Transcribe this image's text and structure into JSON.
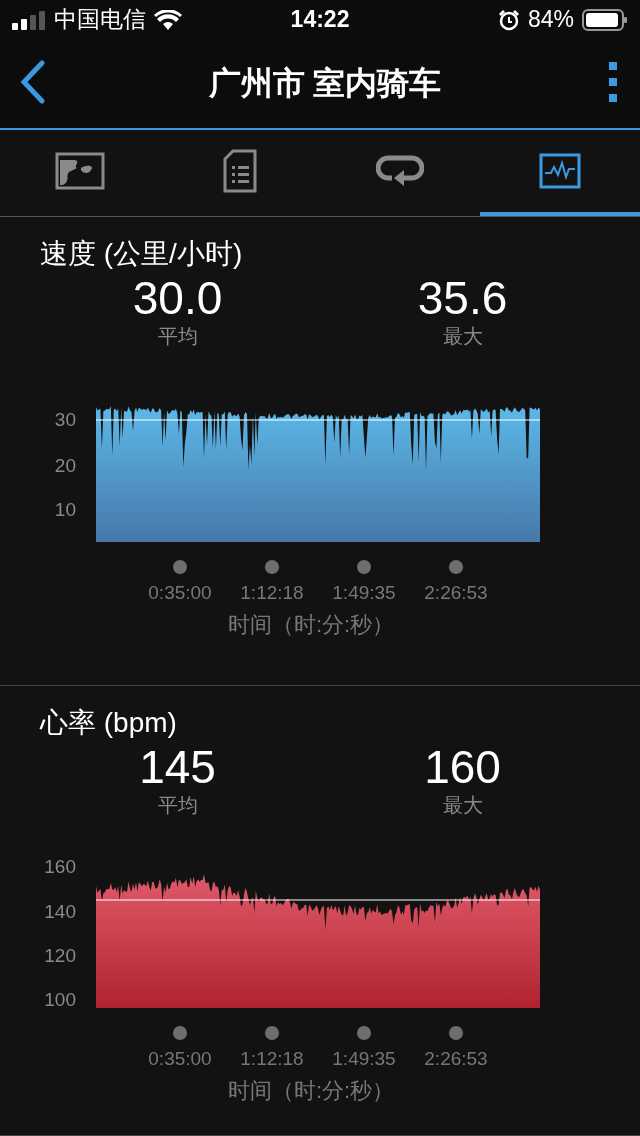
{
  "status_bar": {
    "carrier": "中国电信",
    "time": "14:22",
    "battery": "84%"
  },
  "header": {
    "title": "广州市 室内骑车"
  },
  "tabs": [
    {
      "kind": "map",
      "selected": false
    },
    {
      "kind": "document",
      "selected": false
    },
    {
      "kind": "loop",
      "selected": false
    },
    {
      "kind": "chart",
      "selected": true
    }
  ],
  "sections": [
    {
      "kind": "speed",
      "title": "速度 (公里/小时)",
      "stats": [
        {
          "value": "30.0",
          "label": "平均"
        },
        {
          "value": "35.6",
          "label": "最大"
        }
      ],
      "y_labels": [
        "30",
        "20",
        "10"
      ],
      "x_labels": [
        "0:35:00",
        "1:12:18",
        "1:49:35",
        "2:26:53"
      ],
      "x_title": "时间（时:分:秒）"
    },
    {
      "kind": "heart_rate",
      "title": "心率 (bpm)",
      "stats": [
        {
          "value": "145",
          "label": "平均"
        },
        {
          "value": "160",
          "label": "最大"
        }
      ],
      "y_labels": [
        "160",
        "140",
        "120",
        "100"
      ],
      "x_labels": [
        "0:35:00",
        "1:12:18",
        "1:49:35",
        "2:26:53"
      ],
      "x_title": "时间（时:分:秒）"
    }
  ]
}
